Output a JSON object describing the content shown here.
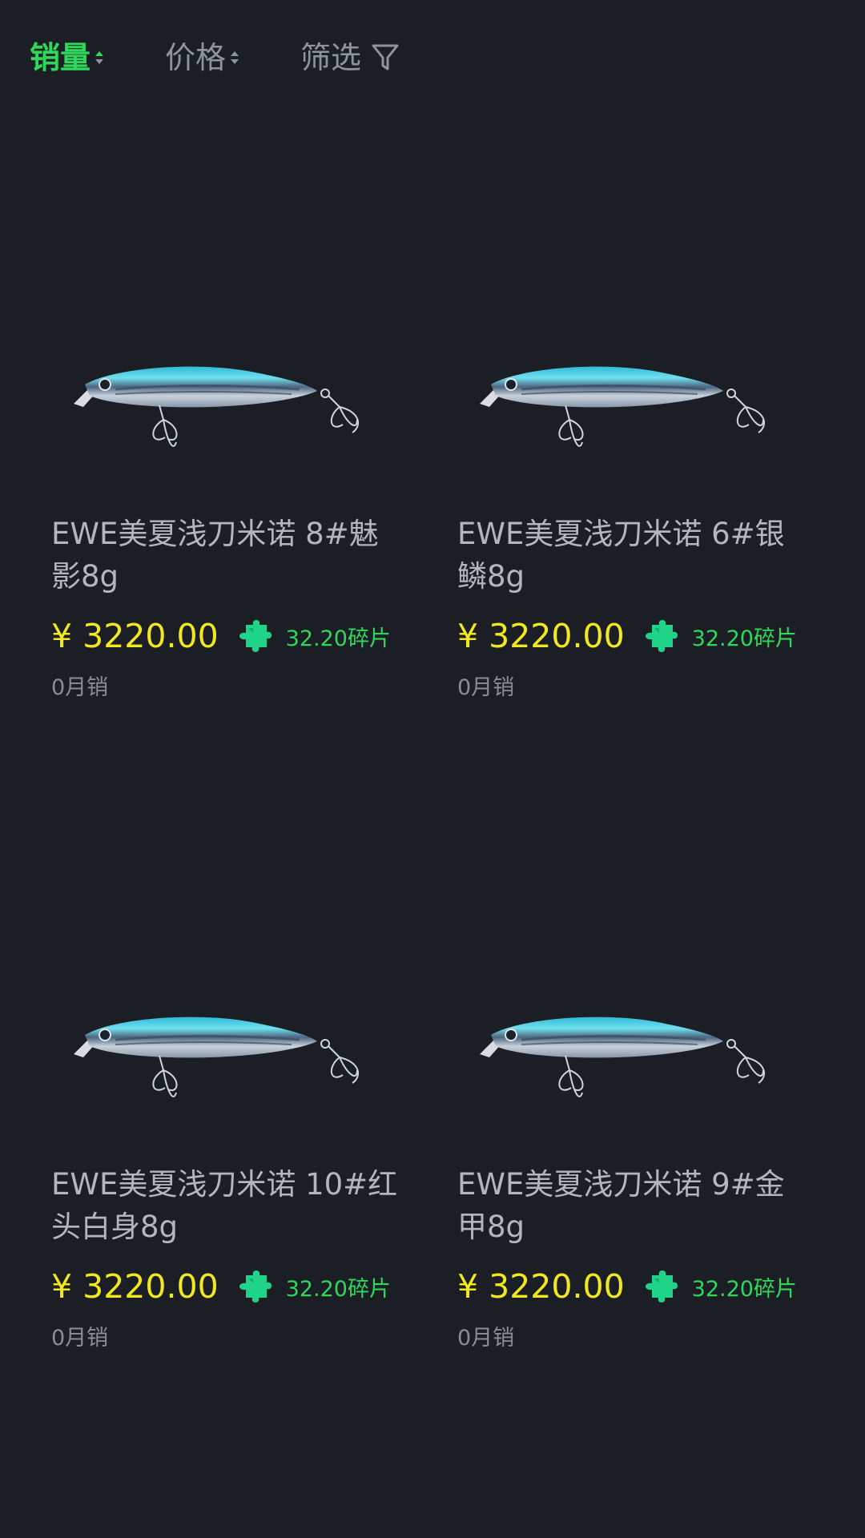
{
  "sort_bar": {
    "sales_label": "销量",
    "price_label": "价格",
    "filter_label": "筛选"
  },
  "colors": {
    "background": "#1c1e25",
    "active_green": "#2fd85b",
    "price_yellow": "#f1e91c",
    "inactive_gray": "#8f939b"
  },
  "products": [
    {
      "title": "EWE美夏浅刀米诺 8#魅影8g",
      "price": "¥ 3220.00",
      "shards": "32.20碎片",
      "sales": "0月销",
      "icon": "puzzle-icon"
    },
    {
      "title": "EWE美夏浅刀米诺 6#银鳞8g",
      "price": "¥ 3220.00",
      "shards": "32.20碎片",
      "sales": "0月销",
      "icon": "puzzle-icon"
    },
    {
      "title": "EWE美夏浅刀米诺 10#红头白身8g",
      "price": "¥ 3220.00",
      "shards": "32.20碎片",
      "sales": "0月销",
      "icon": "puzzle-icon"
    },
    {
      "title": "EWE美夏浅刀米诺 9#金甲8g",
      "price": "¥ 3220.00",
      "shards": "32.20碎片",
      "sales": "0月销",
      "icon": "puzzle-icon"
    }
  ]
}
